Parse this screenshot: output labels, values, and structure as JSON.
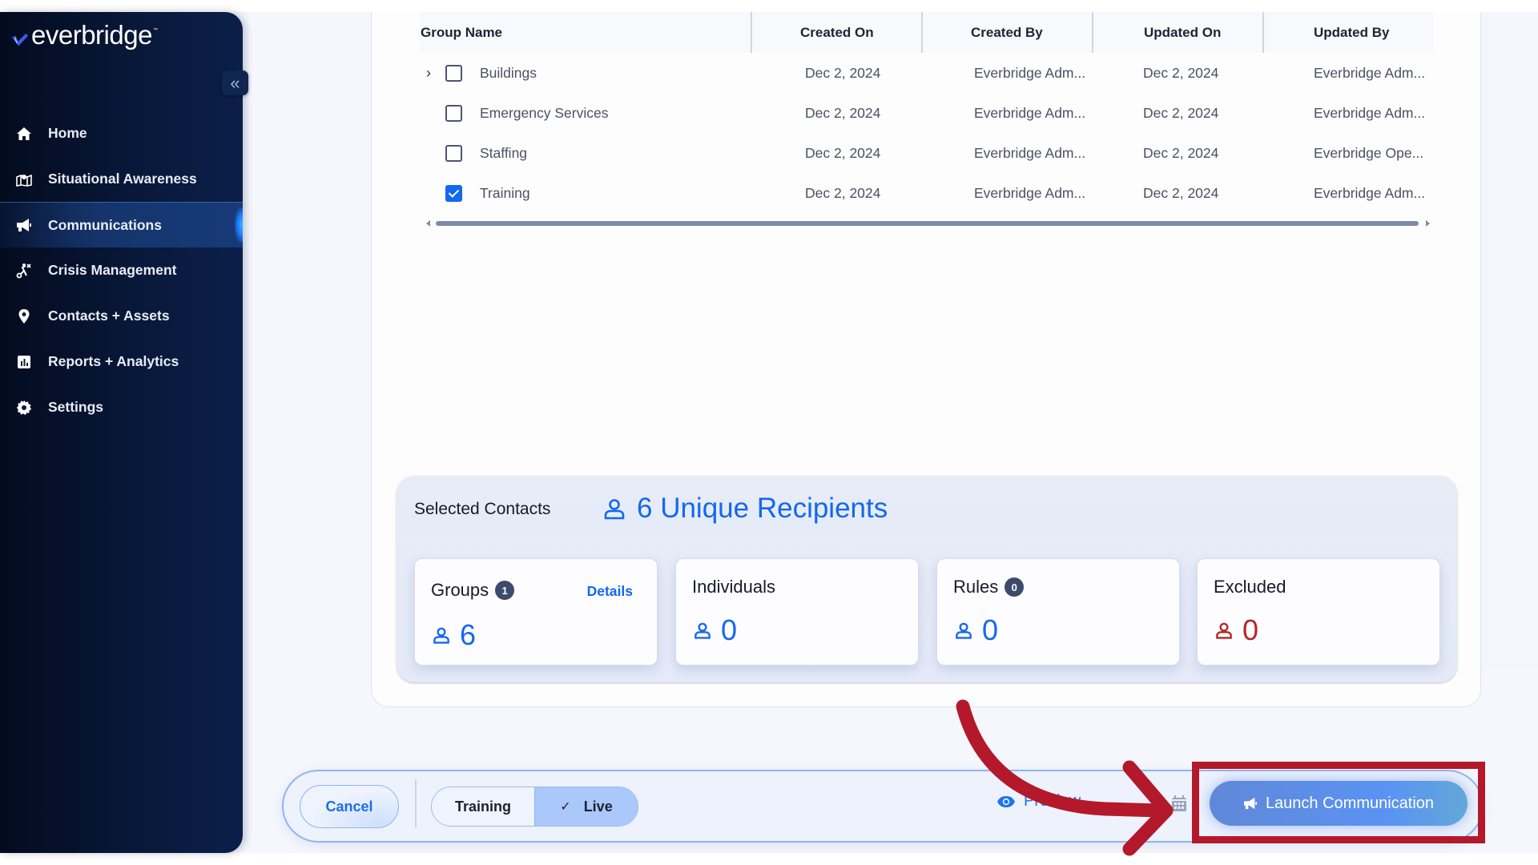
{
  "brand": {
    "name": "everbridge",
    "trademark": "™"
  },
  "sidebar": {
    "collapse_icon": "«",
    "items": [
      {
        "label": "Home",
        "icon": "home-icon",
        "active": false
      },
      {
        "label": "Situational Awareness",
        "icon": "map-icon",
        "active": false
      },
      {
        "label": "Communications",
        "icon": "megaphone-icon",
        "active": true
      },
      {
        "label": "Crisis Management",
        "icon": "crisis-icon",
        "active": false
      },
      {
        "label": "Contacts + Assets",
        "icon": "location-pin-icon",
        "active": false
      },
      {
        "label": "Reports + Analytics",
        "icon": "bar-chart-icon",
        "active": false
      },
      {
        "label": "Settings",
        "icon": "gear-icon",
        "active": false
      }
    ]
  },
  "table": {
    "columns": [
      "Group Name",
      "Created On",
      "Created By",
      "Updated On",
      "Updated By"
    ],
    "rows": [
      {
        "name": "Buildings",
        "expandable": true,
        "checked": false,
        "created_on": "Dec 2, 2024",
        "created_by": "Everbridge Adm...",
        "updated_on": "Dec 2, 2024",
        "updated_by": "Everbridge Adm..."
      },
      {
        "name": "Emergency Services",
        "expandable": false,
        "checked": false,
        "created_on": "Dec 2, 2024",
        "created_by": "Everbridge Adm...",
        "updated_on": "Dec 2, 2024",
        "updated_by": "Everbridge Adm..."
      },
      {
        "name": "Staffing",
        "expandable": false,
        "checked": false,
        "created_on": "Dec 2, 2024",
        "created_by": "Everbridge Adm...",
        "updated_on": "Dec 2, 2024",
        "updated_by": "Everbridge Ope..."
      },
      {
        "name": "Training",
        "expandable": false,
        "checked": true,
        "created_on": "Dec 2, 2024",
        "created_by": "Everbridge Adm...",
        "updated_on": "Dec 2, 2024",
        "updated_by": "Everbridge Adm..."
      }
    ]
  },
  "selected_contacts": {
    "title": "Selected Contacts",
    "unique_recipients": "6 Unique Recipients",
    "cards": [
      {
        "title": "Groups",
        "badge": "1",
        "link": "Details",
        "value": "6",
        "color": "#1467f0"
      },
      {
        "title": "Individuals",
        "badge": null,
        "link": null,
        "value": "0",
        "color": "#1467f0"
      },
      {
        "title": "Rules",
        "badge": "0",
        "link": null,
        "value": "0",
        "color": "#1467f0"
      },
      {
        "title": "Excluded",
        "badge": null,
        "link": null,
        "value": "0",
        "color": "#b4262a"
      }
    ]
  },
  "action_bar": {
    "cancel_label": "Cancel",
    "mode_options": [
      {
        "label": "Training",
        "selected": false
      },
      {
        "label": "Live",
        "selected": true
      }
    ],
    "preview_label": "Preview",
    "launch_label": "Launch Communication"
  },
  "colors": {
    "accent": "#1467f0",
    "sidebar_bg": "#081839",
    "excluded": "#b4262a",
    "annotation": "#b3192a"
  }
}
